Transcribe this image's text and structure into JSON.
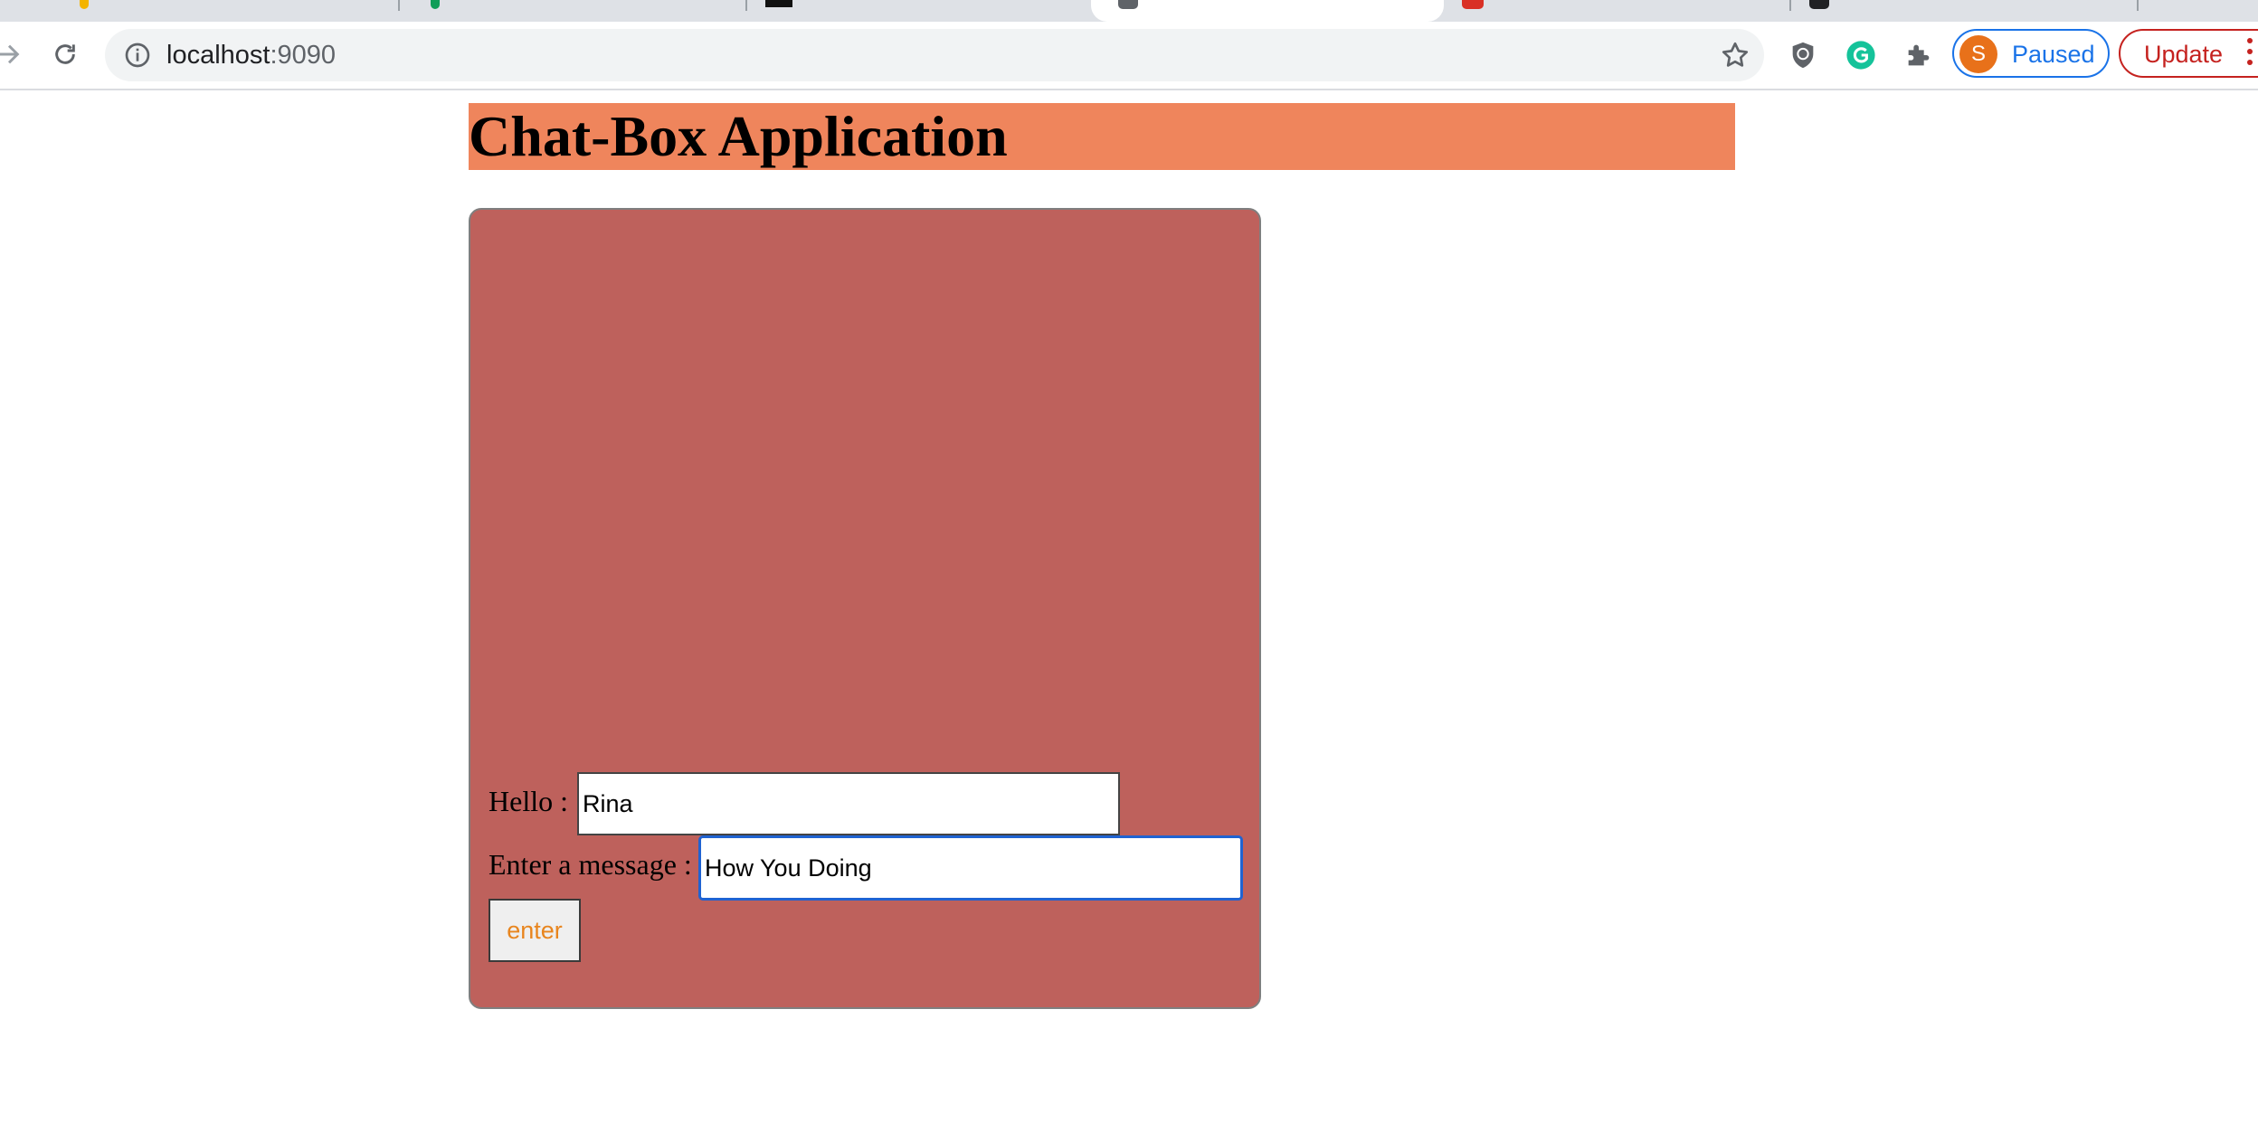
{
  "browser": {
    "url_host": "localhost",
    "url_port": ":9090",
    "profile_initial": "S",
    "profile_status": "Paused",
    "update_label": "Update"
  },
  "page": {
    "title": "Chat-Box Application",
    "hello_label": "Hello :",
    "name_value": "Rina",
    "message_label": "Enter a message :",
    "message_value": "How You Doing",
    "enter_button": "enter"
  },
  "colors": {
    "heading_bg": "#ef855c",
    "chat_box_bg": "#be615c",
    "enter_text": "#e8851e",
    "focus_ring": "#1f63d2"
  }
}
